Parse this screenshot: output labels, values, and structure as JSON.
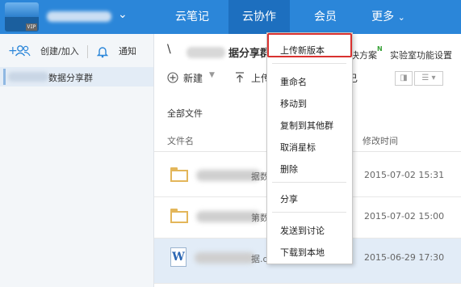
{
  "topbar": {
    "avatar_badge": "VIP",
    "nav": [
      {
        "label": "云笔记"
      },
      {
        "label": "云协作"
      },
      {
        "label": "会员"
      },
      {
        "label": "更多"
      }
    ],
    "active": "云协作",
    "colors": {
      "bar": "#2b86d9",
      "active": "#1d6fbf"
    }
  },
  "sidebar": {
    "create_join": "创建/加入",
    "notify": "通知",
    "group_name_suffix": "数据分享群"
  },
  "main": {
    "title_prefix": "\\",
    "title": "据分享群",
    "solution_text": "决方案",
    "lab_text": "实验室功能设置",
    "new_button": "新建",
    "upload_label": "上传",
    "toolbar_partial": "已",
    "section_label": "全部文件",
    "columns": {
      "name": "文件名",
      "modified": "修改时间"
    },
    "rows": [
      {
        "icon": "folder-icon",
        "name_visible": "据数",
        "time": "2015-07-02 15:31"
      },
      {
        "icon": "folder-icon",
        "name_visible": "第数",
        "time": "2015-07-02 15:00"
      },
      {
        "icon": "word-icon",
        "icon_glyph": "W",
        "name_visible": "据.docx",
        "time": "2015-06-29 17:30",
        "selected": true
      }
    ]
  },
  "context_menu": {
    "highlight_color": "#d9312f",
    "items": [
      {
        "label": "上传新版本"
      },
      {
        "label": "重命名"
      },
      {
        "label": "移动到"
      },
      {
        "label": "复制到其他群"
      },
      {
        "label": "取消星标"
      },
      {
        "label": "删除"
      },
      {
        "label": "分享"
      },
      {
        "label": "发送到讨论"
      },
      {
        "label": "下载到本地"
      }
    ]
  }
}
